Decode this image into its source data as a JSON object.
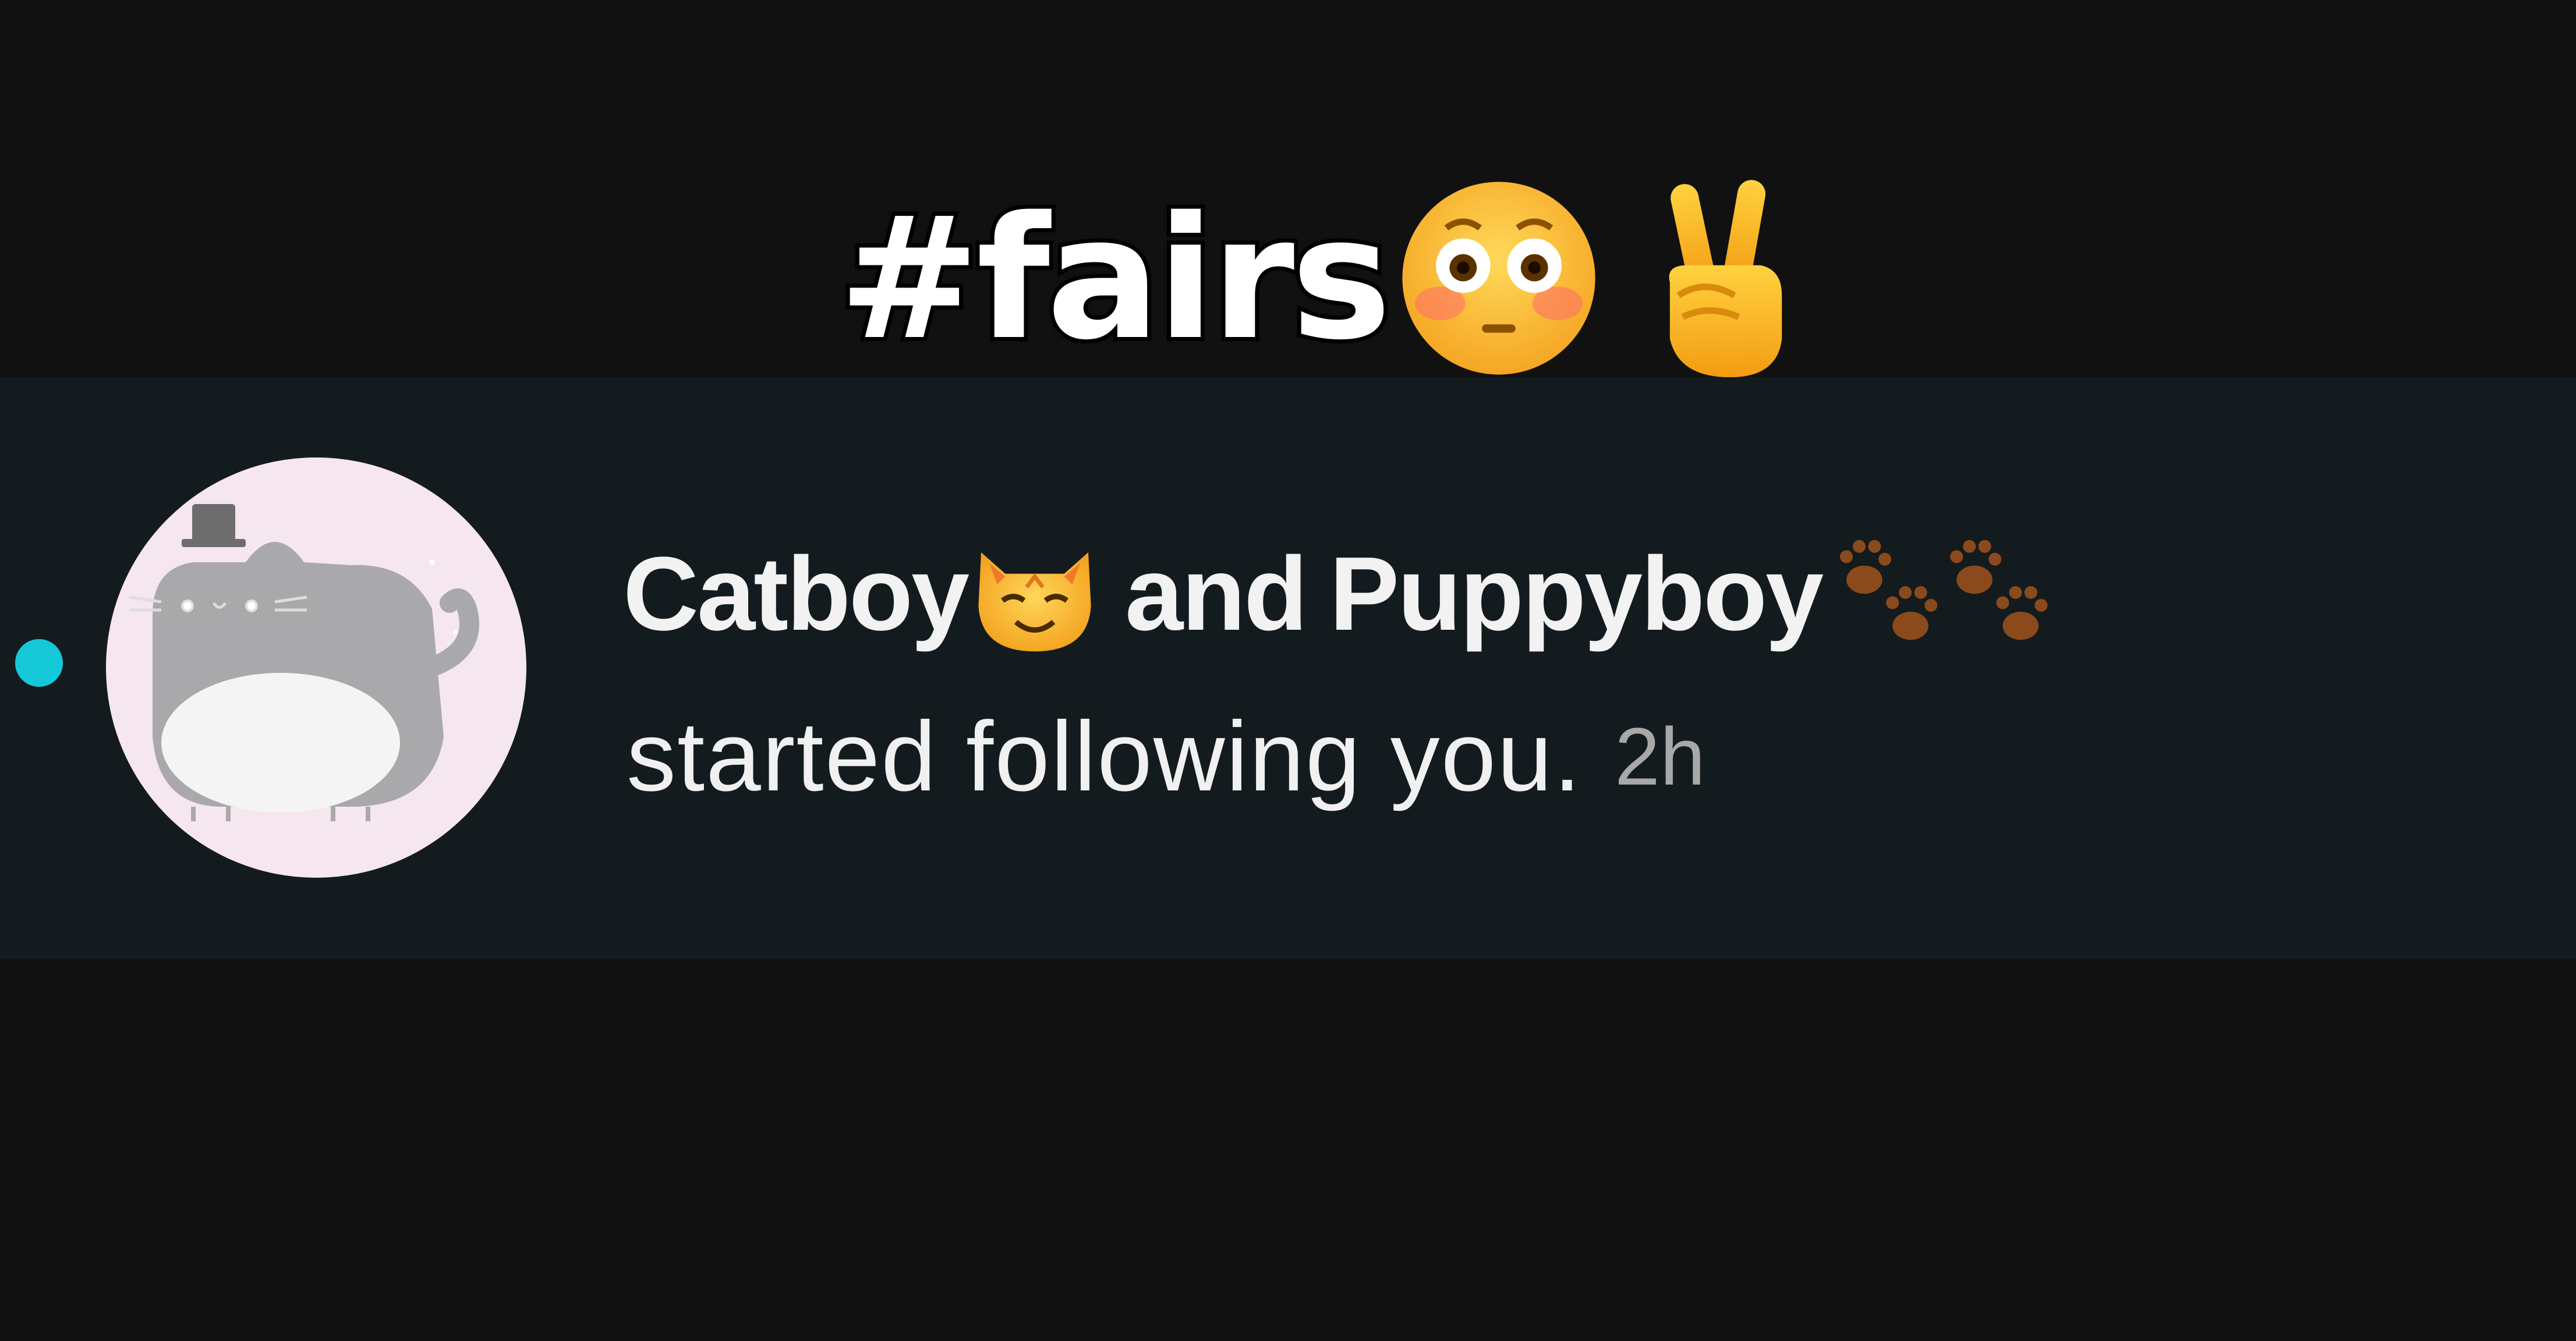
{
  "caption": {
    "text": "#fairs",
    "emojis": [
      "flushed-face-emoji",
      "victory-hand-emoji"
    ]
  },
  "notification": {
    "unread": true,
    "user_one": "Catboy",
    "user_one_emoji": "cat-face-emoji",
    "connector": "and",
    "user_two": "Puppyboy",
    "user_two_emoji": "paw-prints-emoji",
    "message": "started following you.",
    "timestamp": "2h",
    "avatar": "cat-avatar-icon"
  },
  "colors": {
    "background": "#111111",
    "row_background": "#131b1e",
    "unread_dot": "#14c8d8",
    "avatar_background": "#f6e6f0",
    "timestamp": "#a8a8a8"
  }
}
